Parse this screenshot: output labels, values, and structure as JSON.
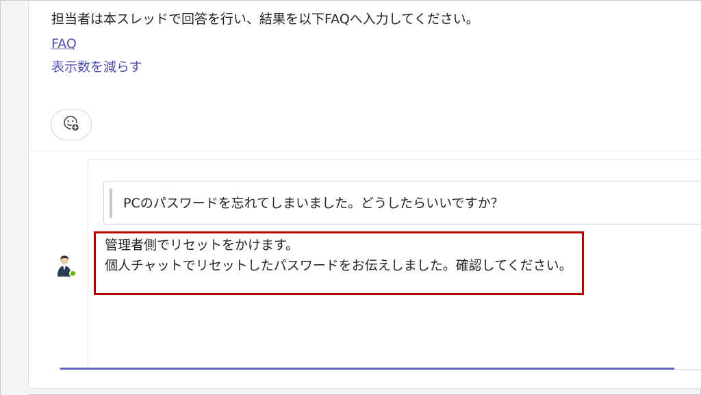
{
  "previous_message": {
    "text": "担当者は本スレッドで回答を行い、結果を以下FAQへ入力してください。",
    "faq_link": "FAQ",
    "show_less": "表示数を減らす"
  },
  "reaction": {
    "icon": "add-reaction-icon"
  },
  "reply": {
    "quote": "PCのパスワードを忘れてしまいました。どうしたらいいですか？",
    "lines": [
      "管理者側でリセットをかけます。",
      "個人チャットでリセットしたパスワードをお伝えしました。確認してください。"
    ],
    "avatar_icon": "user-avatar",
    "presence": "available"
  },
  "colors": {
    "accent": "#5b5fc7",
    "link": "#4f52b2",
    "highlight": "#b00000",
    "presence": "#6bb700"
  }
}
